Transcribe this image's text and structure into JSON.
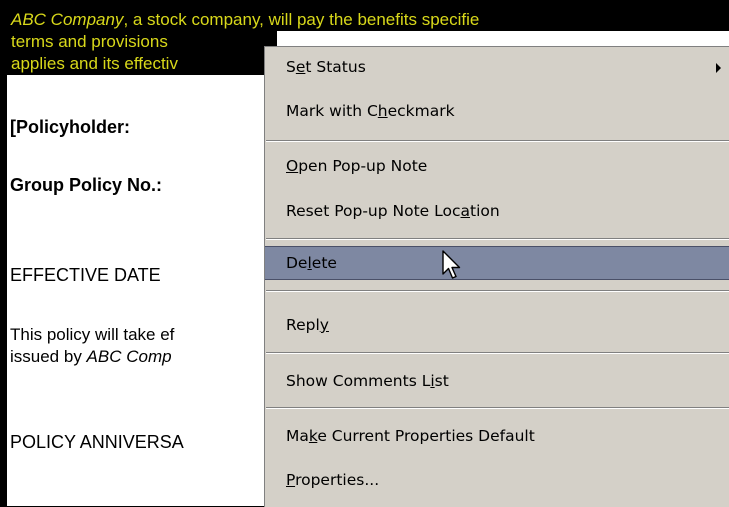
{
  "document": {
    "highlighted_lines": [
      {
        "italic": "ABC Company",
        "text": ", a stock company, will pay the benefits specifie"
      },
      {
        "text": "terms and provisions"
      },
      {
        "text": "applies and its effectiv"
      }
    ],
    "policyholder_label": "[Policyholder:",
    "group_policy_label": "Group Policy No.:",
    "effective_date_heading": "EFFECTIVE DATE",
    "paragraph_line1": "This policy will take ef",
    "paragraph_line2_prefix": "issued by ",
    "paragraph_line2_italic": "ABC Comp",
    "anniversary_heading": "POLICY ANNIVERSA"
  },
  "context_menu": {
    "items": [
      {
        "label": "Set Status",
        "mnemonic": "e",
        "has_submenu": true
      },
      {
        "label": "Mark with Checkmark",
        "mnemonic": "h"
      },
      {
        "label": "Open Pop-up Note",
        "mnemonic": "O"
      },
      {
        "label": "Reset Pop-up Note Location",
        "mnemonic": "a"
      },
      {
        "label": "Delete",
        "mnemonic": "l",
        "selected": true
      },
      {
        "label": "Reply",
        "mnemonic": "y"
      },
      {
        "label": "Show Comments List",
        "mnemonic": "i"
      },
      {
        "label": "Make Current Properties Default",
        "mnemonic": "k"
      },
      {
        "label": "Properties...",
        "mnemonic": "P"
      }
    ]
  },
  "colors": {
    "highlight_bg": "#000000",
    "highlight_text": "#d8d81a",
    "menu_bg": "#d4d0c8",
    "menu_selected": "#7e88a2"
  }
}
